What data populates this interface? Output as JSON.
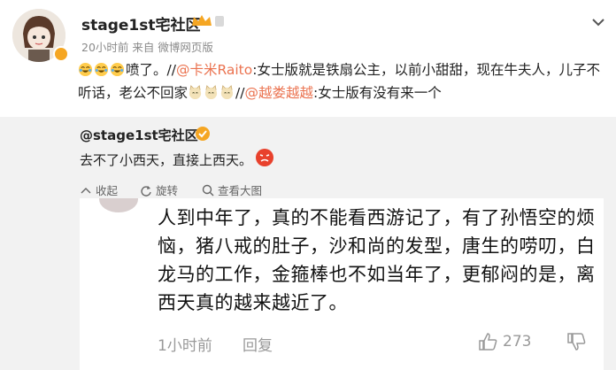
{
  "post": {
    "username": "stage1st宅社区",
    "meta": "20小时前 来自 微博网页版",
    "content": {
      "t1": "喷了。//",
      "m1": "@卡米Raito",
      "t2": ":女士版就是铁扇公主，以前小甜甜，现在牛夫人，儿子不听话，老公不回家",
      "t3": "//",
      "m2": "@越娄越越",
      "t4": ":女士版有没有来一个"
    }
  },
  "repost": {
    "username": "@stage1st宅社区",
    "text": "去不了小西天，直接上西天。",
    "actions": {
      "collect": "收起",
      "forward": "旋转",
      "view_large": "查看大图"
    }
  },
  "comment": {
    "text": "人到中年了，真的不能看西游记了，有了孙悟空的烦恼，猪八戒的肚子，沙和尚的发型，唐生的唠叨，白龙马的工作，金箍棒也不如当年了，更郁闷的是，离西天真的越来越近了。",
    "time": "1小时前",
    "reply": "回复",
    "likes": "273"
  },
  "colors": {
    "mention": "#eb7350",
    "repost_bg": "#f2f2f2",
    "badge": "#f5a623"
  }
}
